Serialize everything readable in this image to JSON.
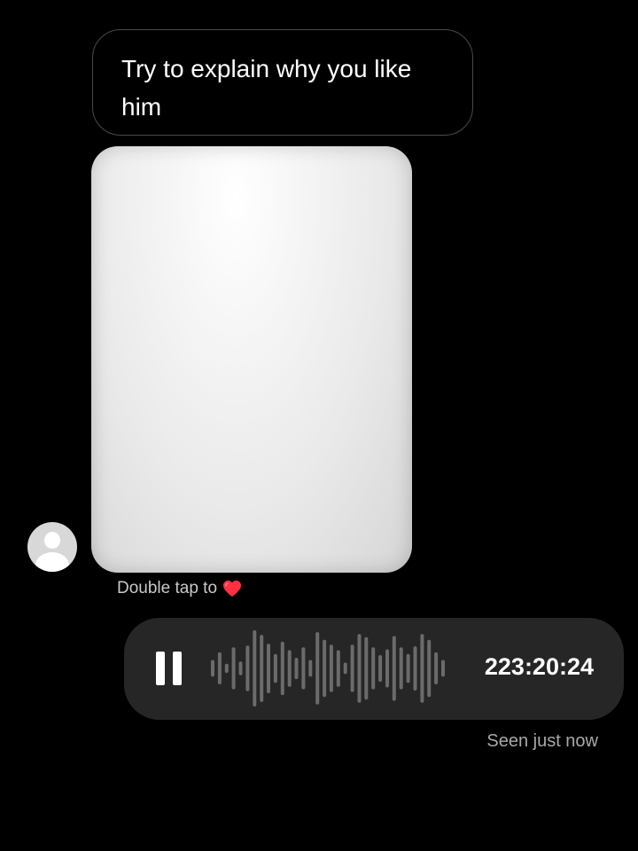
{
  "thread": {
    "incoming_message": "Try to explain why you like him",
    "reaction_hint": "Double tap to",
    "reaction_icon": "heart-icon",
    "reaction_color": "#ff3040"
  },
  "voice_message": {
    "duration": "223:20:24",
    "state_icon": "pause-icon",
    "bubble_color": "#262626",
    "waveform_color": "#6b6b6b",
    "waveform_levels": [
      0.22,
      0.42,
      0.12,
      0.55,
      0.18,
      0.6,
      1.0,
      0.88,
      0.65,
      0.38,
      0.7,
      0.48,
      0.28,
      0.55,
      0.22,
      0.95,
      0.75,
      0.62,
      0.48,
      0.15,
      0.62,
      0.9,
      0.82,
      0.55,
      0.35,
      0.5,
      0.85,
      0.55,
      0.38,
      0.58,
      0.9,
      0.75,
      0.42,
      0.22
    ]
  },
  "status": "Seen just now"
}
